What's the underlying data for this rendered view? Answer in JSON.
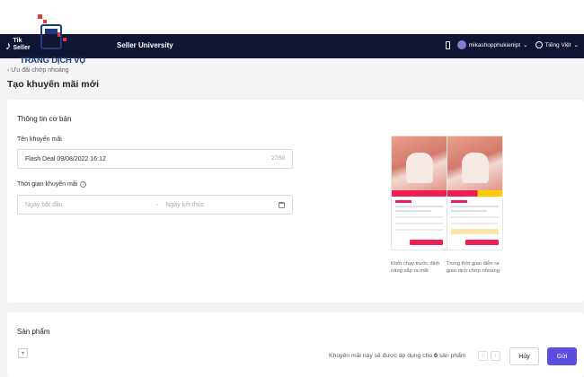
{
  "watermark": {
    "text": "TRANG DỊCH VỤ"
  },
  "navbar": {
    "logo_text_1": "Tik",
    "logo_text_2": "Seller",
    "university": "Seller University",
    "username": "mikashopphukienipt",
    "language": "Tiếng Việt"
  },
  "breadcrumb": {
    "label": "Ưu đãi chớp nhoáng"
  },
  "page": {
    "title": "Tạo khuyến mãi mới"
  },
  "basic_info": {
    "title": "Thông tin cơ bản",
    "name_label": "Tên khuyến mãi",
    "name_value": "Flash Deal 09/08/2022 16:12",
    "name_counter": "27/50",
    "time_label": "Thời gian khuyến mãi",
    "start_placeholder": "Ngày bắt đầu",
    "end_placeholder": "Ngày kết thúc",
    "range_separator": "-"
  },
  "previews": {
    "caption_1": "Khởi chạy trước định năng sắp ra mắt",
    "caption_2": "Trong thời gian diễn ra giao dịch chớp nhoáng"
  },
  "products": {
    "title": "Sản phẩm",
    "note_prefix": "Khuyến mãi này sẽ được áp dụng cho",
    "note_count": "0",
    "note_suffix": "sản phẩm",
    "cancel_label": "Hủy",
    "submit_label": "Gửi"
  },
  "colors": {
    "navbar": "#0f1533",
    "accent": "#ee1d52",
    "primary_button": "#5b4de0"
  },
  "icons": [
    "tiktok-logo-icon",
    "phone-icon",
    "avatar",
    "globe-icon",
    "info-icon",
    "calendar-icon",
    "chevron-left-icon",
    "chevron-right-icon",
    "filter-icon"
  ]
}
